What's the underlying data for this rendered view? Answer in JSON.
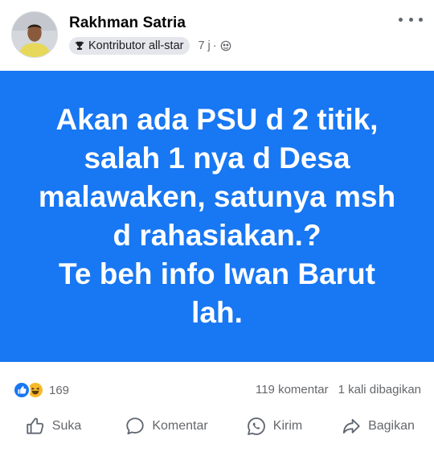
{
  "post": {
    "author": "Rakhman Satria",
    "badge": "Kontributor all-star",
    "time": "7 j",
    "dot": "·",
    "text": "Akan ada PSU d 2 titik,\nsalah 1 nya d Desa\nmalawaken, satunya msh\nd rahasiakan.?\nTe beh info Iwan Barut\nlah.",
    "background_color": "#1877f2",
    "text_color": "#ffffff"
  },
  "stats": {
    "reaction_count": "169",
    "reaction_icons": [
      "like-icon",
      "haha-icon"
    ],
    "comments": "119 komentar",
    "shares": "1 kali dibagikan"
  },
  "actions": {
    "like": "Suka",
    "comment": "Komentar",
    "send": "Kirim",
    "share": "Bagikan"
  },
  "icons": {
    "badge": "trophy-icon",
    "audience": "globe-icon",
    "more": "more-options-icon"
  },
  "colors": {
    "accent": "#1877f2",
    "secondary_text": "#65676b",
    "haha": "#f7b928"
  }
}
